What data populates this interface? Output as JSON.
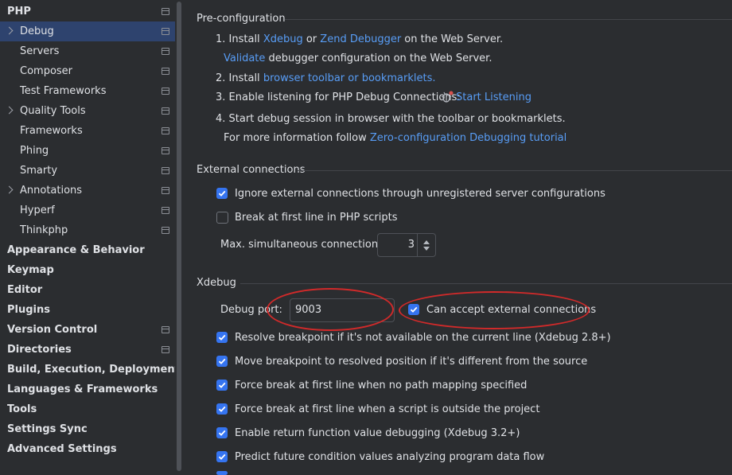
{
  "sidebar": {
    "items": [
      {
        "label": "PHP",
        "bold": true,
        "chevron": false,
        "project": true,
        "selected": false
      },
      {
        "label": "Debug",
        "bold": false,
        "chevron": true,
        "project": true,
        "selected": true
      },
      {
        "label": "Servers",
        "bold": false,
        "chevron": false,
        "project": true,
        "selected": false
      },
      {
        "label": "Composer",
        "bold": false,
        "chevron": false,
        "project": true,
        "selected": false
      },
      {
        "label": "Test Frameworks",
        "bold": false,
        "chevron": false,
        "project": true,
        "selected": false
      },
      {
        "label": "Quality Tools",
        "bold": false,
        "chevron": true,
        "project": true,
        "selected": false
      },
      {
        "label": "Frameworks",
        "bold": false,
        "chevron": false,
        "project": true,
        "selected": false
      },
      {
        "label": "Phing",
        "bold": false,
        "chevron": false,
        "project": true,
        "selected": false
      },
      {
        "label": "Smarty",
        "bold": false,
        "chevron": false,
        "project": true,
        "selected": false
      },
      {
        "label": "Annotations",
        "bold": false,
        "chevron": true,
        "project": true,
        "selected": false
      },
      {
        "label": "Hyperf",
        "bold": false,
        "chevron": false,
        "project": true,
        "selected": false
      },
      {
        "label": "Thinkphp",
        "bold": false,
        "chevron": false,
        "project": true,
        "selected": false
      },
      {
        "label": "Appearance & Behavior",
        "bold": true,
        "chevron": false,
        "project": false,
        "selected": false
      },
      {
        "label": "Keymap",
        "bold": true,
        "chevron": false,
        "project": false,
        "selected": false
      },
      {
        "label": "Editor",
        "bold": true,
        "chevron": false,
        "project": false,
        "selected": false
      },
      {
        "label": "Plugins",
        "bold": true,
        "chevron": false,
        "project": false,
        "selected": false
      },
      {
        "label": "Version Control",
        "bold": true,
        "chevron": false,
        "project": true,
        "selected": false
      },
      {
        "label": "Directories",
        "bold": true,
        "chevron": false,
        "project": true,
        "selected": false
      },
      {
        "label": "Build, Execution, Deployment",
        "bold": true,
        "chevron": false,
        "project": false,
        "selected": false
      },
      {
        "label": "Languages & Frameworks",
        "bold": true,
        "chevron": false,
        "project": false,
        "selected": false
      },
      {
        "label": "Tools",
        "bold": true,
        "chevron": false,
        "project": false,
        "selected": false
      },
      {
        "label": "Settings Sync",
        "bold": true,
        "chevron": false,
        "project": false,
        "selected": false
      },
      {
        "label": "Advanced Settings",
        "bold": true,
        "chevron": false,
        "project": false,
        "selected": false
      }
    ]
  },
  "preconfig": {
    "title": "Pre-configuration",
    "step1_prefix": "1. Install ",
    "xdebug_link": "Xdebug",
    "or": " or ",
    "zend_link": "Zend Debugger",
    "step1_suffix": " on the Web Server.",
    "validate_link": "Validate",
    "validate_suffix": " debugger configuration on the Web Server.",
    "step2_prefix": "2. Install ",
    "toolbar_link": "browser toolbar or bookmarklets.",
    "step3_prefix": "3. Enable listening for PHP Debug Connections:",
    "start_listening_link": "Start Listening",
    "step4": "4. Start debug session in browser with the toolbar or bookmarklets.",
    "more_info_prefix": "For more information follow ",
    "tutorial_link": "Zero-configuration Debugging tutorial"
  },
  "external": {
    "title": "External connections",
    "ignore_label": "Ignore external connections through unregistered server configurations",
    "ignore_checked": true,
    "break_label": "Break at first line in PHP scripts",
    "break_checked": false,
    "max_label": "Max. simultaneous connections:",
    "max_value": "3"
  },
  "xdebug": {
    "title": "Xdebug",
    "port_label": "Debug port:",
    "port_value": "9003",
    "accept_label": "Can accept external connections",
    "accept_checked": true,
    "options": [
      {
        "label": "Resolve breakpoint if it's not available on the current line (Xdebug 2.8+)",
        "checked": true
      },
      {
        "label": "Move breakpoint to resolved position if it's different from the source",
        "checked": true
      },
      {
        "label": "Force break at first line when no path mapping specified",
        "checked": true
      },
      {
        "label": "Force break at first line when a script is outside the project",
        "checked": true
      },
      {
        "label": "Enable return function value debugging (Xdebug 3.2+)",
        "checked": true
      },
      {
        "label": "Predict future condition values analyzing program data flow",
        "checked": true
      }
    ]
  },
  "colors": {
    "accent": "#3574f0",
    "link": "#589df6",
    "highlight_ellipse": "#d12a2a",
    "selection": "#2e436e"
  }
}
